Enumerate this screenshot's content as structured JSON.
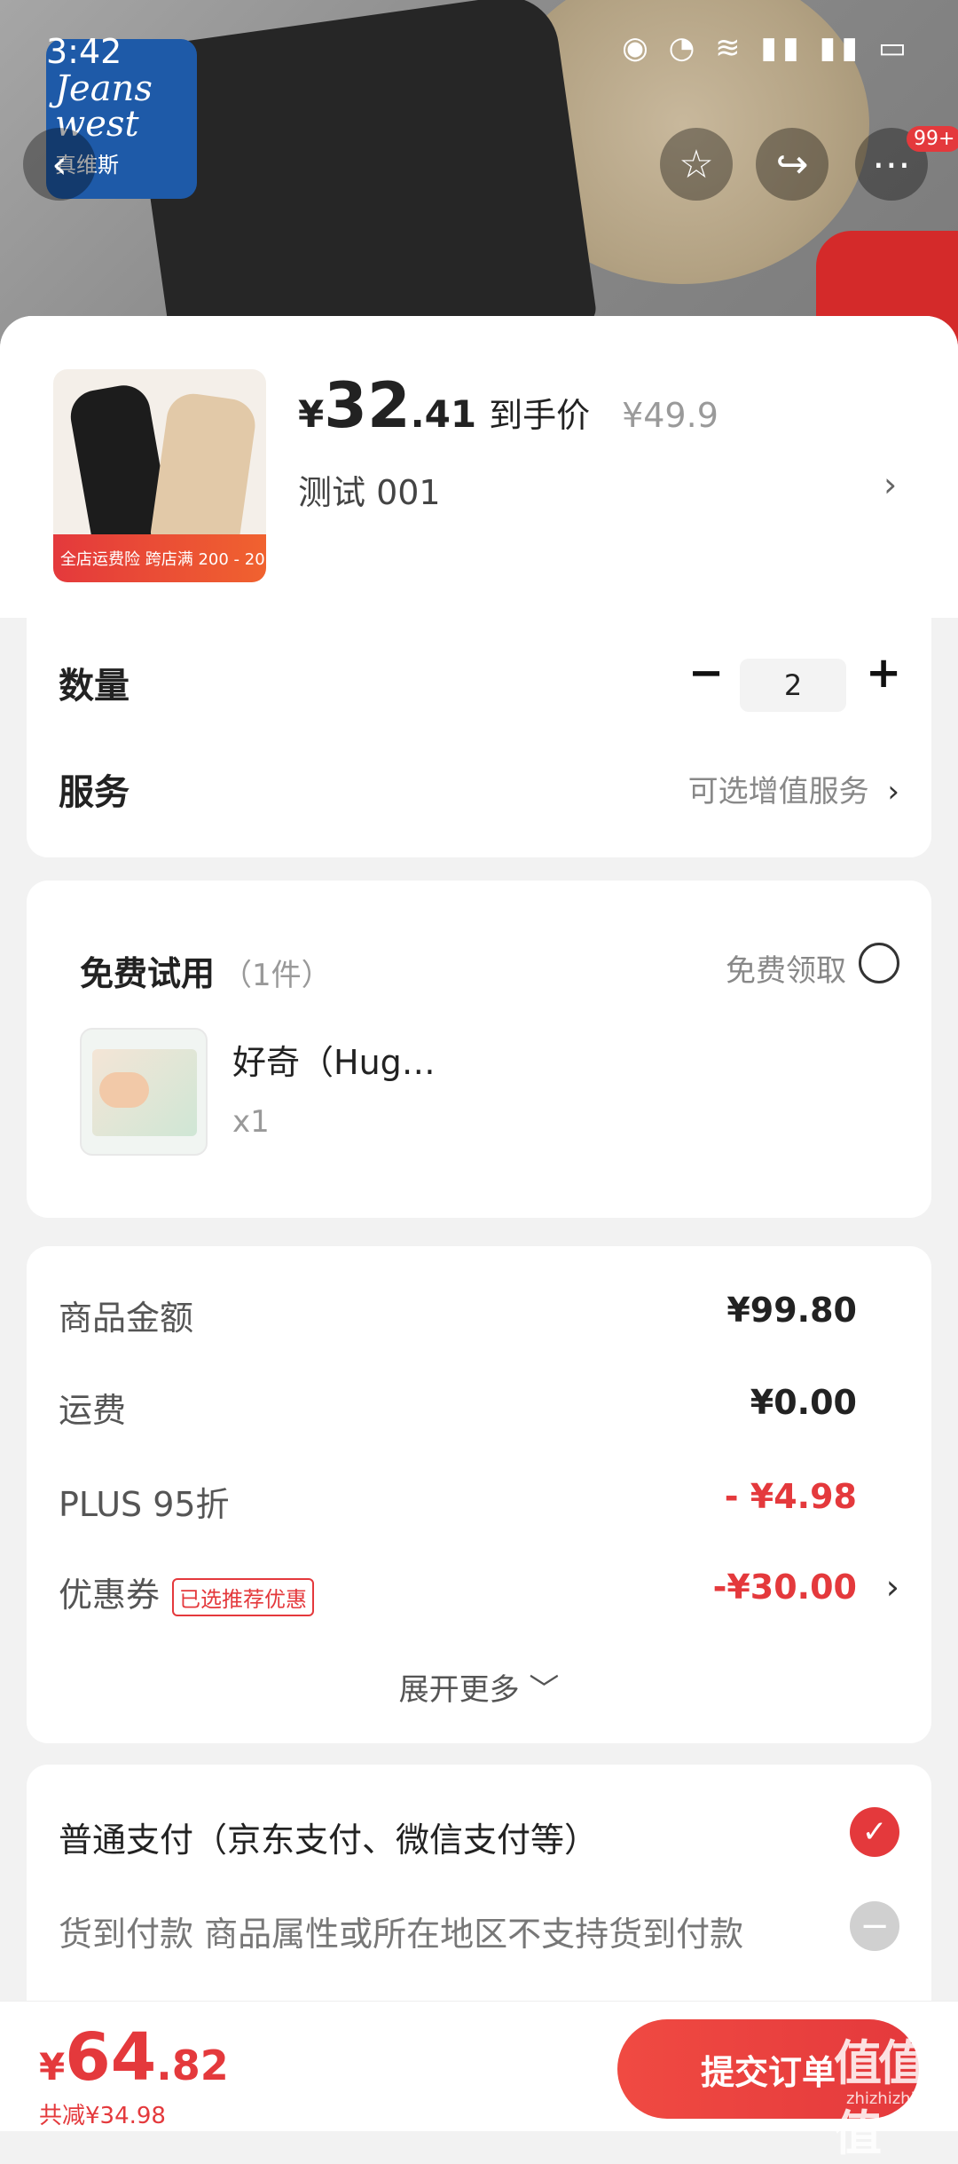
{
  "status_bar": {
    "time": "3:42",
    "icons": [
      "eye-icon",
      "alarm-icon",
      "wifi-icon",
      "4g-signal-icon",
      "4g-signal-icon",
      "battery-icon"
    ]
  },
  "header_overlay": {
    "brand_logo_en": "Jeans west",
    "brand_logo_cn": "真维斯",
    "notification_badge": "99+"
  },
  "product": {
    "thumb_tag": "全店运费险  跨店满 200 - 20",
    "price_currency": "¥",
    "price_int": "32",
    "price_dec": ".41",
    "price_label": "到手价",
    "original_price": "¥49.9",
    "spec": "测试  001"
  },
  "quantity": {
    "label": "数量",
    "value": "2",
    "minus": "−",
    "plus": "+"
  },
  "service": {
    "label": "服务",
    "value": "可选增值服务"
  },
  "free_trial": {
    "title": "免费试用",
    "count": "（1件）",
    "action": "免费领取",
    "item_name": "好奇（Hug…",
    "item_qty": "x1"
  },
  "fees": {
    "goods_label": "商品金额",
    "goods_value": "¥99.80",
    "shipping_label": "运费",
    "shipping_value": "¥0.00",
    "plus_label": "PLUS 95折",
    "plus_value": "- ¥4.98",
    "coupon_label": "优惠券",
    "coupon_tag": "已选推荐优惠",
    "coupon_value": "-¥30.00",
    "expand": "展开更多"
  },
  "payment": {
    "normal": "普通支付（京东支付、微信支付等）",
    "cod": "货到付款  商品属性或所在地区不支持货到付款"
  },
  "bottom": {
    "currency": "¥",
    "total_int": "64",
    "total_dec": ".82",
    "saved": "共减¥34.98",
    "submit": "提交订单",
    "watermark": "值值值",
    "watermark_url": "zhizhizhi.com"
  },
  "colors": {
    "accent": "#e4393c",
    "background": "#f2f2f2"
  }
}
